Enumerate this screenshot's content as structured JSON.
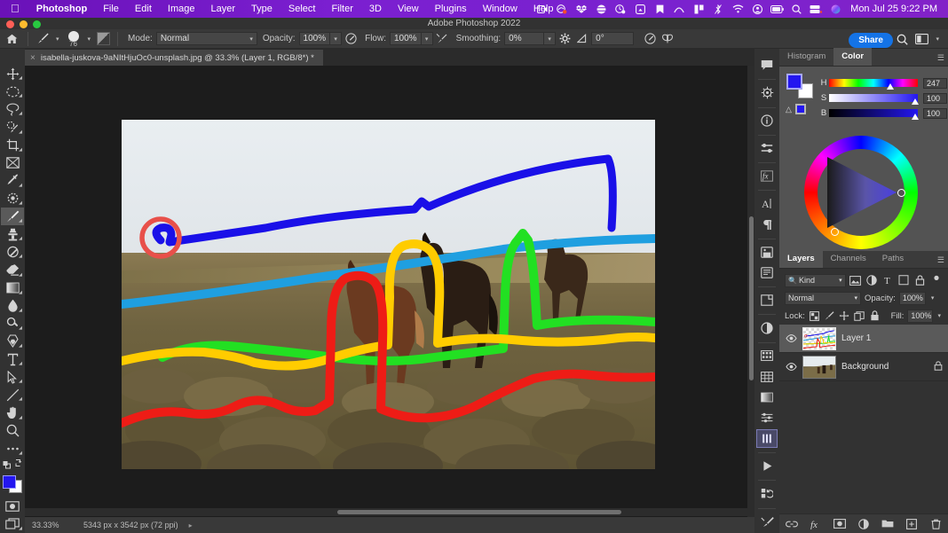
{
  "macbar": {
    "apple_icon": "apple-icon",
    "menus": [
      "Photoshop",
      "File",
      "Edit",
      "Image",
      "Layer",
      "Type",
      "Select",
      "Filter",
      "3D",
      "View",
      "Plugins",
      "Window",
      "Help"
    ],
    "status_icons": [
      "screen-record-icon",
      "paint-drop-icon",
      "dropbox-icon",
      "globe-icon",
      "time-machine-icon",
      "airplay-icon",
      "bookmark-icon",
      "arc-icon",
      "column-icon",
      "bluetooth-off-icon",
      "wifi-icon",
      "user-account-icon",
      "battery-icon",
      "spotlight-search-icon",
      "control-center-icon",
      "siri-icon"
    ],
    "clock": "Mon Jul 25  9:22 PM"
  },
  "window": {
    "title": "Adobe Photoshop 2022"
  },
  "options_bar": {
    "home_icon": "home-icon",
    "brush_preset_icon": "brush-icon",
    "brush_size": "76",
    "brush_settings_icon": "brush-settings-icon",
    "mode_label": "Mode:",
    "mode_value": "Normal",
    "opacity_label": "Opacity:",
    "opacity_value": "100%",
    "opacity_pressure_icon": "pressure-opacity-icon",
    "flow_label": "Flow:",
    "flow_value": "100%",
    "airbrush_icon": "airbrush-icon",
    "smoothing_label": "Smoothing:",
    "smoothing_value": "0%",
    "smoothing_gear_icon": "gear-icon",
    "angle_icon": "angle-icon",
    "angle_value": "0°",
    "pressure_size_icon": "pressure-size-icon",
    "symmetry_icon": "symmetry-butterfly-icon",
    "share_label": "Share",
    "search_icon": "search-icon",
    "workspace_icon": "workspace-switcher-icon",
    "workspace_caret": "chevron-down-icon"
  },
  "document": {
    "tab_close_icon": "close-icon",
    "tab_title": "isabella-juskova-9aNItHjuOc0-unsplash.jpg @ 33.3% (Layer 1, RGB/8*) *"
  },
  "status_bar": {
    "zoom": "33.33%",
    "dimensions": "5343 px x 3542 px (72 ppi)",
    "arrow_icon": "chevron-right-icon"
  },
  "left_tools": [
    {
      "name": "move-tool",
      "icon": "move-icon",
      "active": false,
      "has_flyout": true
    },
    {
      "name": "marquee-tool",
      "icon": "elliptical-marquee-icon",
      "active": false,
      "has_flyout": true
    },
    {
      "name": "lasso-tool",
      "icon": "lasso-icon",
      "active": false,
      "has_flyout": true
    },
    {
      "name": "object-selection-tool",
      "icon": "quick-selection-icon",
      "active": false,
      "has_flyout": true
    },
    {
      "name": "crop-tool",
      "icon": "crop-icon",
      "active": false,
      "has_flyout": true
    },
    {
      "name": "frame-tool",
      "icon": "frame-icon",
      "active": false,
      "has_flyout": false
    },
    {
      "name": "eyedropper-tool",
      "icon": "eyedropper-icon",
      "active": false,
      "has_flyout": true
    },
    {
      "name": "spot-healing-tool",
      "icon": "spot-healing-brush-icon",
      "active": false,
      "has_flyout": true
    },
    {
      "name": "brush-tool",
      "icon": "brush-icon",
      "active": true,
      "has_flyout": true
    },
    {
      "name": "clone-stamp-tool",
      "icon": "clone-stamp-icon",
      "active": false,
      "has_flyout": true
    },
    {
      "name": "history-brush-tool",
      "icon": "history-brush-icon",
      "active": false,
      "has_flyout": true
    },
    {
      "name": "eraser-tool",
      "icon": "eraser-icon",
      "active": false,
      "has_flyout": true
    },
    {
      "name": "gradient-tool",
      "icon": "gradient-icon",
      "active": false,
      "has_flyout": true
    },
    {
      "name": "blur-tool",
      "icon": "blur-drop-icon",
      "active": false,
      "has_flyout": true
    },
    {
      "name": "dodge-tool",
      "icon": "dodge-icon",
      "active": false,
      "has_flyout": true
    },
    {
      "name": "pen-tool",
      "icon": "pen-icon",
      "active": false,
      "has_flyout": true
    },
    {
      "name": "type-tool",
      "icon": "type-icon",
      "active": false,
      "has_flyout": true
    },
    {
      "name": "path-selection-tool",
      "icon": "path-selection-arrow-icon",
      "active": false,
      "has_flyout": true
    },
    {
      "name": "line-tool",
      "icon": "line-shape-icon",
      "active": false,
      "has_flyout": true
    },
    {
      "name": "hand-tool",
      "icon": "hand-icon",
      "active": false,
      "has_flyout": true
    },
    {
      "name": "zoom-tool",
      "icon": "zoom-magnifier-icon",
      "active": false,
      "has_flyout": false
    },
    {
      "name": "edit-toolbar",
      "icon": "ellipsis-icon",
      "active": false,
      "has_flyout": false
    }
  ],
  "left_tools_bottom": {
    "default_colors_icon": "default-colors-icon",
    "swap_colors_icon": "swap-colors-icon",
    "foreground_color": "#2316f0",
    "background_color": "#ffffff",
    "quick_mask_icon": "quick-mask-icon",
    "screen_mode_icon": "screen-mode-icon"
  },
  "right_rail": [
    {
      "name": "comments-panel",
      "icon": "comment-bubble-icon",
      "selected": false
    },
    {
      "name": "discover-panel",
      "icon": "discover-ship-wheel-icon",
      "selected": false
    },
    {
      "name": "info-panel",
      "icon": "info-circle-icon",
      "selected": false
    },
    {
      "name": "adjustments-panel",
      "icon": "adjustments-sliders-icon",
      "selected": false
    },
    {
      "name": "styles-panel",
      "icon": "fx-icon",
      "selected": false
    },
    {
      "name": "character-panel",
      "icon": "character-A-icon",
      "selected": false
    },
    {
      "name": "paragraph-panel",
      "icon": "paragraph-pilcrow-icon",
      "selected": false
    },
    {
      "name": "libraries-panel",
      "icon": "libraries-book-icon",
      "selected": false
    },
    {
      "name": "notes-panel",
      "icon": "notes-page-icon",
      "selected": false
    },
    {
      "name": "properties-panel",
      "icon": "properties-square-icon",
      "selected": false
    },
    {
      "name": "adjustment-layer-panel",
      "icon": "half-circle-contrast-icon",
      "selected": false
    },
    {
      "name": "swatches-panel",
      "icon": "swatches-grid-icon",
      "selected": false
    },
    {
      "name": "patterns-panel",
      "icon": "patterns-grid-icon",
      "selected": false
    },
    {
      "name": "gradients-panel",
      "icon": "gradient-bar-icon",
      "selected": false
    },
    {
      "name": "brush-settings-panel",
      "icon": "brush-settings-sliders-icon",
      "selected": false
    },
    {
      "name": "brushes-panel",
      "icon": "brushes-bars-icon",
      "selected": true
    },
    {
      "name": "actions-panel",
      "icon": "play-triangle-icon",
      "selected": false
    },
    {
      "name": "history-panel",
      "icon": "history-undo-icon",
      "selected": false
    },
    {
      "name": "tool-presets-panel",
      "icon": "tool-presets-brush-icon",
      "selected": false
    }
  ],
  "color_panel": {
    "tabs": [
      {
        "label": "Histogram",
        "active": false
      },
      {
        "label": "Color",
        "active": true
      }
    ],
    "menu_icon": "panel-menu-icon",
    "foreground_color": "#2316f0",
    "background_color": "#ffffff",
    "warning_icon": "out-of-gamut-warning-icon",
    "sliders": [
      {
        "channel": "H",
        "value": "247",
        "unit": "°",
        "position_pct": 69
      },
      {
        "channel": "S",
        "value": "100",
        "unit": "%",
        "position_pct": 99
      },
      {
        "channel": "B",
        "value": "100",
        "unit": "%",
        "position_pct": 99
      }
    ],
    "wheel_options_icon": "color-wheel-options-icon"
  },
  "layers_panel": {
    "tabs": [
      {
        "label": "Layers",
        "active": true
      },
      {
        "label": "Channels",
        "active": false
      },
      {
        "label": "Paths",
        "active": false
      }
    ],
    "menu_icon": "panel-menu-icon",
    "filter": {
      "search_icon": "search-icon",
      "kind_label": "Kind",
      "caret_icon": "chevron-down-icon",
      "filter_icons": [
        "pixel-layer-filter-icon",
        "adjustment-layer-filter-icon",
        "type-layer-filter-icon",
        "shape-layer-filter-icon",
        "smart-object-filter-icon",
        "toggle-filter-icon"
      ]
    },
    "blend_mode": "Normal",
    "opacity_label": "Opacity:",
    "opacity_value": "100%",
    "lock_label": "Lock:",
    "lock_icons": [
      "lock-transparent-pixels-icon",
      "lock-image-pixels-icon",
      "lock-position-icon",
      "lock-artboard-nesting-icon",
      "lock-all-icon"
    ],
    "fill_label": "Fill:",
    "fill_value": "100%",
    "layers": [
      {
        "name": "Layer 1",
        "visible": true,
        "selected": true,
        "locked": false,
        "eye_icon": "eye-icon"
      },
      {
        "name": "Background",
        "visible": true,
        "selected": false,
        "locked": true,
        "eye_icon": "eye-icon",
        "lock_icon": "lock-icon"
      }
    ],
    "footer_icons": [
      "link-layers-icon",
      "layer-fx-icon",
      "layer-mask-icon",
      "new-adjustment-layer-icon",
      "new-group-icon",
      "new-layer-icon",
      "delete-layer-icon"
    ]
  },
  "canvas": {
    "image_description": "Icelandic horses grazing on a grassy hillside under an overcast sky",
    "annotation_strokes": [
      {
        "name": "blue-sky-stroke",
        "color": "#1a10e8"
      },
      {
        "name": "red-circle-highlight",
        "color": "#e8504a"
      },
      {
        "name": "light-blue-horizon-stroke",
        "color": "#1f9fe0"
      },
      {
        "name": "green-grass-stroke",
        "color": "#22e022"
      },
      {
        "name": "yellow-mid-stroke",
        "color": "#ffcc00"
      },
      {
        "name": "red-foreground-stroke",
        "color": "#ee1c16"
      }
    ]
  }
}
